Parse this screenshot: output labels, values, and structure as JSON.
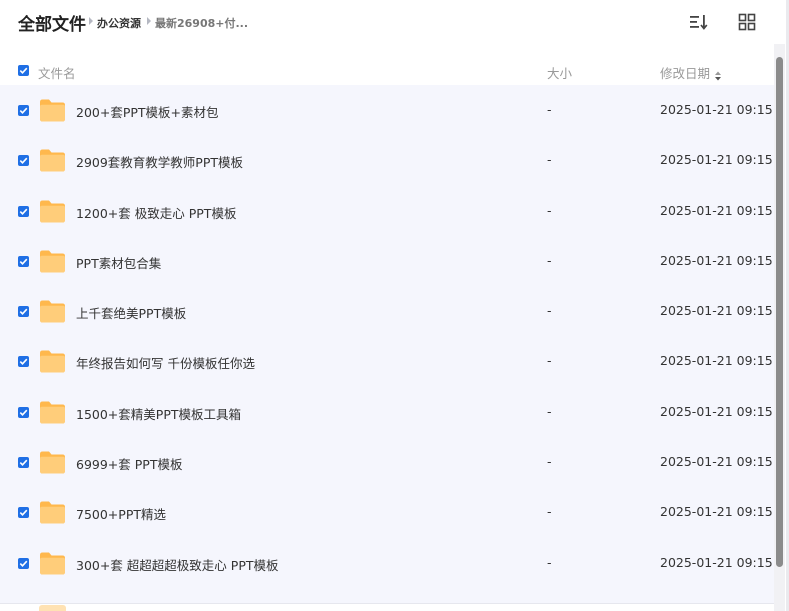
{
  "breadcrumb": {
    "root": "全部文件",
    "level1": "办公资源",
    "level2": "最新26908+付..."
  },
  "toolbar": {
    "sort_icon": "sort-list-icon",
    "grid_icon": "grid-view-icon"
  },
  "columns": {
    "name": "文件名",
    "size": "大小",
    "date": "修改日期"
  },
  "colors": {
    "accent": "#1f6fe5",
    "folder": "#ffc76b",
    "list_bg": "#f5f6fd"
  },
  "files": [
    {
      "name": "200+套PPT模板+素材包",
      "size": "-",
      "date": "2025-01-21 09:15",
      "checked": true
    },
    {
      "name": "2909套教育教学教师PPT模板",
      "size": "-",
      "date": "2025-01-21 09:15",
      "checked": true
    },
    {
      "name": "1200+套 极致走心 PPT模板",
      "size": "-",
      "date": "2025-01-21 09:15",
      "checked": true
    },
    {
      "name": "PPT素材包合集",
      "size": "-",
      "date": "2025-01-21 09:15",
      "checked": true
    },
    {
      "name": "上千套绝美PPT模板",
      "size": "-",
      "date": "2025-01-21 09:15",
      "checked": true
    },
    {
      "name": "年终报告如何写 千份模板任你选",
      "size": "-",
      "date": "2025-01-21 09:15",
      "checked": true
    },
    {
      "name": "1500+套精美PPT模板工具箱",
      "size": "-",
      "date": "2025-01-21 09:15",
      "checked": true
    },
    {
      "name": "6999+套 PPT模板",
      "size": "-",
      "date": "2025-01-21 09:15",
      "checked": true
    },
    {
      "name": "7500+PPT精选",
      "size": "-",
      "date": "2025-01-21 09:15",
      "checked": true
    },
    {
      "name": "300+套 超超超超极致走心 PPT模板",
      "size": "-",
      "date": "2025-01-21 09:15",
      "checked": true
    }
  ]
}
